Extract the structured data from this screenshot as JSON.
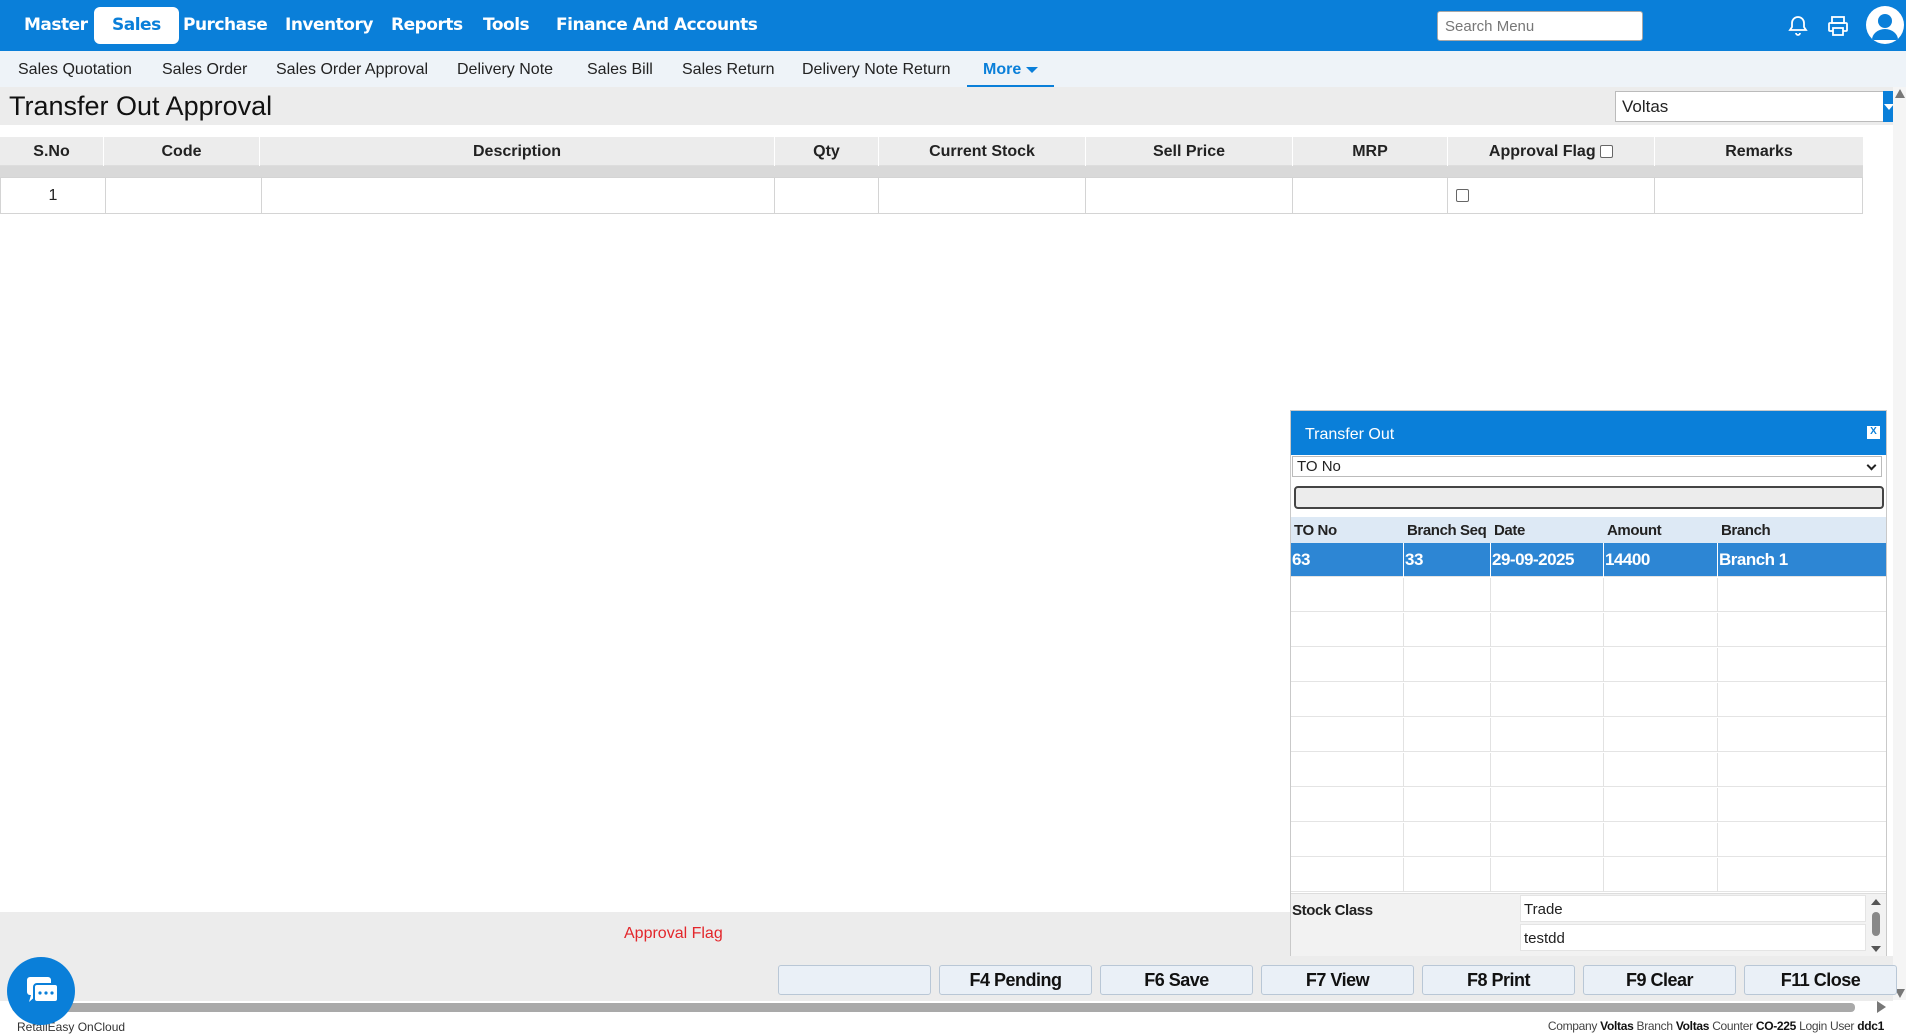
{
  "topnav": {
    "items": [
      "Master",
      "Sales",
      "Purchase",
      "Inventory",
      "Reports",
      "Tools",
      "Finance And Accounts"
    ],
    "active": "Sales",
    "search_placeholder": "Search Menu"
  },
  "subnav": {
    "items": [
      "Sales Quotation",
      "Sales Order",
      "Sales Order Approval",
      "Delivery Note",
      "Sales Bill",
      "Sales Return",
      "Delivery Note Return"
    ],
    "more_label": "More"
  },
  "page": {
    "title": "Transfer Out Approval",
    "branch_value": "Voltas"
  },
  "grid": {
    "columns": [
      "S.No",
      "Code",
      "Description",
      "Qty",
      "Current Stock",
      "Sell Price",
      "MRP",
      "Approval Flag",
      "Remarks"
    ],
    "rows": [
      {
        "sno": "1",
        "code": "",
        "description": "",
        "qty": "",
        "current_stock": "",
        "sell_price": "",
        "mrp": "",
        "approval_flag": false,
        "remarks": ""
      }
    ]
  },
  "modal": {
    "title": "Transfer Out",
    "close_label": "X",
    "filter_select": "TO No",
    "search_value": "",
    "columns": [
      "TO No",
      "Branch Seq",
      "Date",
      "Amount",
      "Branch"
    ],
    "rows": [
      {
        "to_no": "63",
        "branch_seq": "33",
        "date": "29-09-2025",
        "amount": "14400",
        "branch": "Branch 1"
      }
    ],
    "footer": {
      "label": "Stock Class",
      "values": [
        "Trade",
        "testdd"
      ]
    }
  },
  "status": {
    "message": "Approval Flag"
  },
  "toolbar": {
    "blank_label": "",
    "pending_label": "F4 Pending",
    "save_label": "F6 Save",
    "view_label": "F7 View",
    "print_label": "F8 Print",
    "clear_label": "F9 Clear",
    "close_label": "F11 Close"
  },
  "footer": {
    "brand": "RetailEasy OnCloud",
    "company_label": "Company",
    "company_value": "Voltas",
    "branch_label": "Branch",
    "branch_value": "Voltas",
    "counter_label": "Counter",
    "counter_value": "CO-225",
    "user_label": "Login User",
    "user_value": "ddc1"
  },
  "colors": {
    "primary": "#0a7fd9",
    "selected_row": "#2d86d4",
    "status_text": "#e3262b"
  },
  "icons": [
    "bell-icon",
    "printer-icon",
    "user-avatar-icon",
    "chat-icon",
    "close-icon",
    "chevron-down-icon"
  ]
}
